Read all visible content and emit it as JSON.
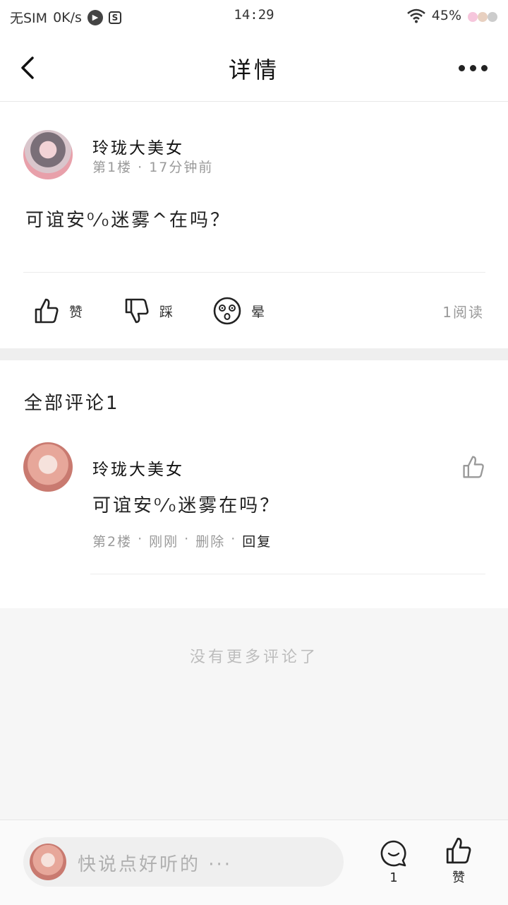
{
  "status_bar": {
    "carrier": "无SIM",
    "speed": "0K/s",
    "time": "14:29",
    "battery": "45%",
    "icons": [
      "play-circle-icon",
      "s-square-icon",
      "wifi-icon",
      "emoji-icons"
    ]
  },
  "header": {
    "title": "详情",
    "back_icon": "chevron-left-icon",
    "more_icon": "more-dots-icon"
  },
  "post": {
    "author": "玲珑大美女",
    "meta": "第1楼 · 17分钟前",
    "content": "可谊安⁰⁄₀迷雾^在吗？",
    "actions": [
      {
        "icon": "thumbs-up-icon",
        "label": "赞"
      },
      {
        "icon": "thumbs-down-icon",
        "label": "踩"
      },
      {
        "icon": "dizzy-face-icon",
        "label": "晕"
      }
    ],
    "read_count": "1阅读"
  },
  "comments": {
    "title": "全部评论1",
    "items": [
      {
        "author": "玲珑大美女",
        "content": "可谊安⁰⁄₀迷雾在吗？",
        "floor": "第2楼",
        "time": "刚刚",
        "delete_label": "删除",
        "reply_label": "回复"
      }
    ],
    "no_more": "没有更多评论了"
  },
  "bottom_bar": {
    "placeholder": "快说点好听的 ···",
    "comment_count": "1",
    "like_label": "赞"
  },
  "colors": {
    "text_primary": "#222222",
    "text_secondary": "#9a9a9a",
    "divider": "#ececec",
    "footer_bg": "#f6f6f6"
  }
}
